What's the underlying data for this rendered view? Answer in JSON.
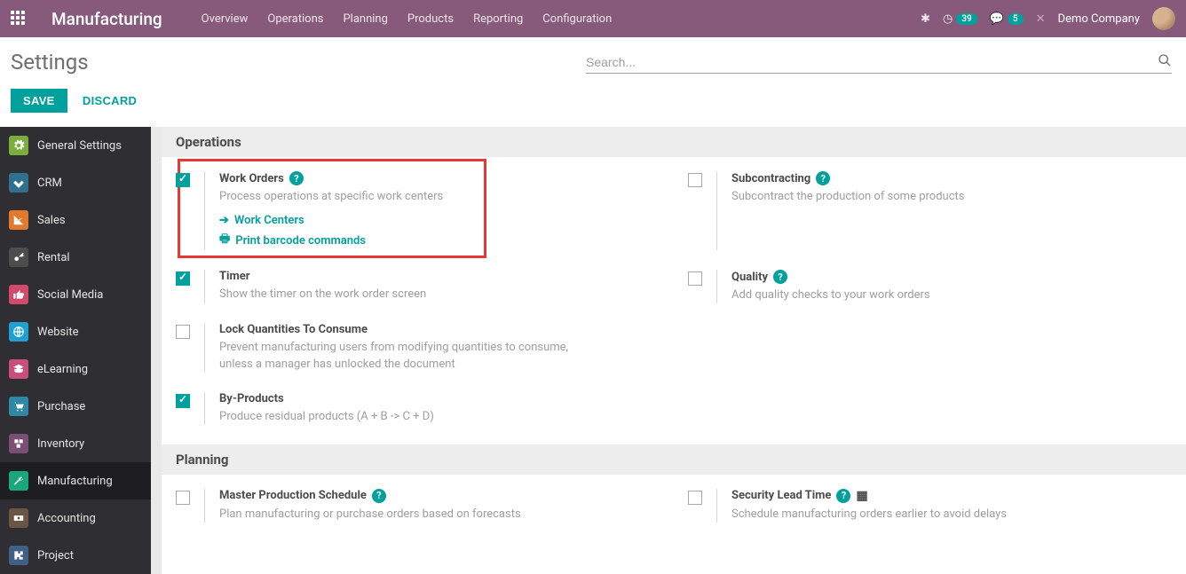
{
  "navbar": {
    "brand": "Manufacturing",
    "links": [
      "Overview",
      "Operations",
      "Planning",
      "Products",
      "Reporting",
      "Configuration"
    ],
    "activities_badge": "39",
    "messages_badge": "5",
    "company": "Demo Company"
  },
  "page": {
    "title": "Settings",
    "search_placeholder": "Search...",
    "save_label": "SAVE",
    "discard_label": "DISCARD"
  },
  "sidebar": {
    "items": [
      {
        "label": "General Settings",
        "color": "#7bae3f"
      },
      {
        "label": "CRM",
        "color": "#2f6f8f"
      },
      {
        "label": "Sales",
        "color": "#e07b2e"
      },
      {
        "label": "Rental",
        "color": "#4d4d4d"
      },
      {
        "label": "Social Media",
        "color": "#d24a6b"
      },
      {
        "label": "Website",
        "color": "#1fa0d0"
      },
      {
        "label": "eLearning",
        "color": "#c94f7b"
      },
      {
        "label": "Purchase",
        "color": "#2f87a6"
      },
      {
        "label": "Inventory",
        "color": "#7a4f73"
      },
      {
        "label": "Manufacturing",
        "color": "#1aa87a"
      },
      {
        "label": "Accounting",
        "color": "#6b5545"
      },
      {
        "label": "Project",
        "color": "#3f5f87"
      }
    ]
  },
  "sections": {
    "operations": {
      "title": "Operations",
      "work_orders": {
        "title": "Work Orders",
        "desc": "Process operations at specific work centers",
        "link1": "Work Centers",
        "link2": "Print barcode commands"
      },
      "subcontracting": {
        "title": "Subcontracting",
        "desc": "Subcontract the production of some products"
      },
      "timer": {
        "title": "Timer",
        "desc": "Show the timer on the work order screen"
      },
      "quality": {
        "title": "Quality",
        "desc": "Add quality checks to your work orders"
      },
      "lock_qty": {
        "title": "Lock Quantities To Consume",
        "desc": "Prevent manufacturing users from modifying quantities to consume, unless a manager has unlocked the document"
      },
      "by_products": {
        "title": "By-Products",
        "desc": "Produce residual products (A + B -> C + D)"
      }
    },
    "planning": {
      "title": "Planning",
      "mps": {
        "title": "Master Production Schedule",
        "desc": "Plan manufacturing or purchase orders based on forecasts"
      },
      "slt": {
        "title": "Security Lead Time",
        "desc": "Schedule manufacturing orders earlier to avoid delays"
      }
    }
  }
}
